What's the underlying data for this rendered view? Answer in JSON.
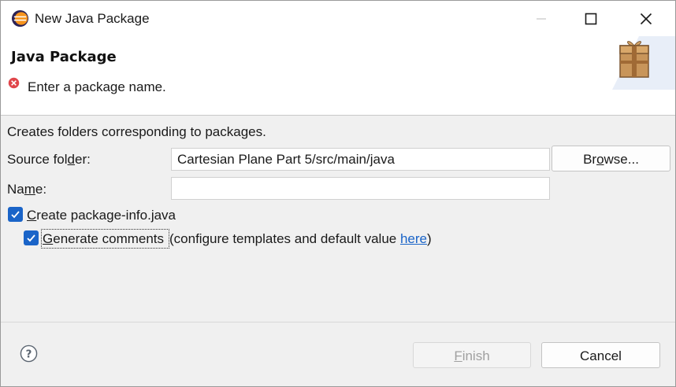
{
  "window": {
    "title": "New Java Package",
    "icon": "eclipse-icon",
    "controls": [
      "minimize-icon",
      "maximize-icon",
      "close-icon"
    ]
  },
  "banner": {
    "title": "Java Package",
    "message": "Enter a package name.",
    "message_icon": "error-icon",
    "art_icon": "package-gift-icon"
  },
  "form": {
    "description": "Creates folders corresponding to packages.",
    "source_folder": {
      "label_pre": "Source fol",
      "label_mnemonic": "d",
      "label_post": "er:",
      "value": "Cartesian Plane Part 5/src/main/java"
    },
    "browse_button": {
      "pre": "Br",
      "mnemonic": "o",
      "post": "wse..."
    },
    "name": {
      "label_pre": "Na",
      "label_mnemonic": "m",
      "label_post": "e:",
      "value": "",
      "placeholder": ""
    },
    "create_package_info": {
      "label_mnemonic": "C",
      "label_post": "reate package-info.java",
      "checked": true
    },
    "generate_comments": {
      "label_mnemonic": "G",
      "label_post": "enerate comments",
      "checked": true,
      "suffix_pre": " (configure templates and default value ",
      "link": "here",
      "suffix_post": ")"
    }
  },
  "footer": {
    "help_icon": "help-icon",
    "finish": {
      "mnemonic": "F",
      "post": "inish",
      "enabled": false
    },
    "cancel": "Cancel"
  },
  "colors": {
    "accent": "#1a64c8",
    "error": "#e0464b",
    "disabled_text": "#a0a0a0"
  }
}
